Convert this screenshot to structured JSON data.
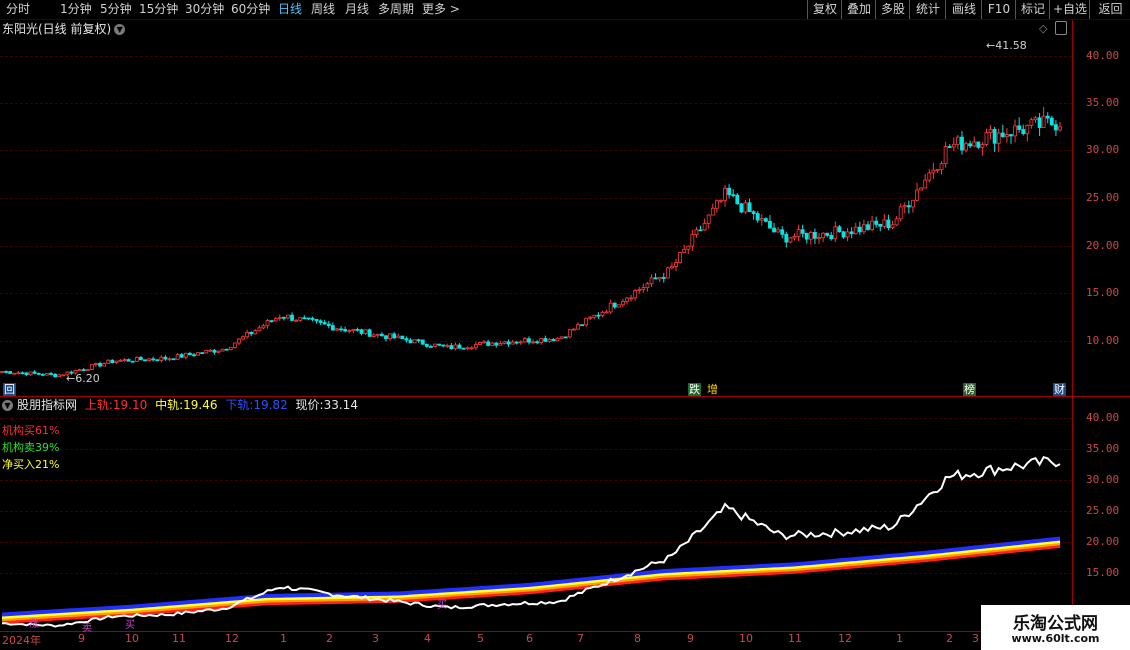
{
  "toolbar": {
    "periods": [
      "分时",
      "1分钟",
      "5分钟",
      "15分钟",
      "30分钟",
      "60分钟",
      "日线",
      "周线",
      "月线",
      "多周期",
      "更多 >"
    ],
    "active_period": "日线",
    "right_buttons": [
      "复权",
      "叠加",
      "多股",
      "统计",
      "画线",
      "F10",
      "+自选",
      "返回"
    ],
    "extra_button": "标记"
  },
  "main": {
    "title": "东阳光(日线 前复权)",
    "high_label": "41.58",
    "low_label": "6.20",
    "y_labels": [
      "40.00",
      "35.00",
      "30.00",
      "25.00",
      "20.00",
      "15.00",
      "10.00"
    ],
    "markers": [
      {
        "text": "回",
        "color": "#ffffff",
        "bg": "#1b4a8a"
      },
      {
        "text": "跌",
        "color": "#ffffff",
        "bg": "#1f6a2a"
      },
      {
        "text": "增",
        "color": "#ffd200",
        "bg": "#000000"
      },
      {
        "text": "榜",
        "color": "#ffffff",
        "bg": "#2e5d2e"
      },
      {
        "text": "财",
        "color": "#ffffff",
        "bg": "#1b4a8a"
      }
    ]
  },
  "indicator": {
    "name": "股朋指标网",
    "upper_label": "上轨:",
    "upper_value": "19.10",
    "mid_label": "中轨:",
    "mid_value": "19.46",
    "lower_label": "下轨:",
    "lower_value": "19.82",
    "price_label": "现价:",
    "price_value": "33.14",
    "legend": [
      {
        "text": "机构买61%",
        "color": "#ff3030"
      },
      {
        "text": "机构卖39%",
        "color": "#30e030"
      },
      {
        "text": "净买入21%",
        "color": "#ffff30"
      }
    ],
    "y_labels": [
      "40.00",
      "35.00",
      "30.00",
      "25.00",
      "20.00",
      "15.00"
    ],
    "bottom_markers": [
      "涨",
      "卖",
      "买"
    ]
  },
  "x_axis": {
    "labels": [
      "2024年",
      "9",
      "10",
      "11",
      "12",
      "1",
      "2",
      "3",
      "4",
      "5",
      "6",
      "7",
      "8",
      "9",
      "10",
      "11",
      "12",
      "1",
      "2",
      "3"
    ]
  },
  "watermark": {
    "line1": "乐淘公式网",
    "line2": "www.60lt.com"
  },
  "colors": {
    "up": "#ff3a3a",
    "down": "#00e6e6",
    "grid": "#3c0000",
    "axis": "#a00000",
    "price_line": "#ffffff"
  },
  "chart_data": {
    "type": "line",
    "title": "东阳光(日线 前复权)",
    "ylim_main": [
      5,
      43
    ],
    "ylim_indicator": [
      12,
      42
    ],
    "close_series": [
      {
        "x": "2024-08",
        "y": 6.9
      },
      {
        "x": "2024-09",
        "y": 6.5
      },
      {
        "x": "2024-10",
        "y": 8.0
      },
      {
        "x": "2024-11",
        "y": 8.3
      },
      {
        "x": "2024-12",
        "y": 9.3
      },
      {
        "x": "2025-01",
        "y": 12.8
      },
      {
        "x": "2025-02",
        "y": 11.5
      },
      {
        "x": "2025-03",
        "y": 10.5
      },
      {
        "x": "2025-04",
        "y": 9.4
      },
      {
        "x": "2025-05",
        "y": 10.0
      },
      {
        "x": "2025-06",
        "y": 10.4
      },
      {
        "x": "2025-07",
        "y": 14.0
      },
      {
        "x": "2025-08",
        "y": 17.5
      },
      {
        "x": "2025-09",
        "y": 25.5
      },
      {
        "x": "2025-10",
        "y": 21.0
      },
      {
        "x": "2025-11",
        "y": 21.5
      },
      {
        "x": "2025-12",
        "y": 22.5
      },
      {
        "x": "2026-01",
        "y": 30.5
      },
      {
        "x": "2026-02",
        "y": 32.0
      },
      {
        "x": "2026-03",
        "y": 33.14
      }
    ],
    "band_series": [
      {
        "x": "2024-08",
        "y": 7.2
      },
      {
        "x": "2024-11",
        "y": 8.5
      },
      {
        "x": "2025-02",
        "y": 10.2
      },
      {
        "x": "2025-05",
        "y": 10.6
      },
      {
        "x": "2025-08",
        "y": 12.0
      },
      {
        "x": "2025-10",
        "y": 14.2
      },
      {
        "x": "2025-12",
        "y": 15.3
      },
      {
        "x": "2026-02",
        "y": 17.2
      },
      {
        "x": "2026-03",
        "y": 19.46
      }
    ]
  }
}
